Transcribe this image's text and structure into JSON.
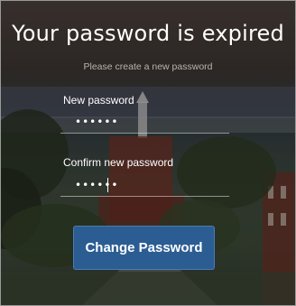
{
  "page": {
    "title": "Your password is expired",
    "subtitle": "Please create a new password"
  },
  "form": {
    "new_password": {
      "label": "New password",
      "value": "123456"
    },
    "confirm_password": {
      "label": "Confirm new password",
      "value": "123456"
    },
    "submit_label": "Change Password"
  },
  "colors": {
    "button": "#2b5d93",
    "text": "#ffffff"
  }
}
